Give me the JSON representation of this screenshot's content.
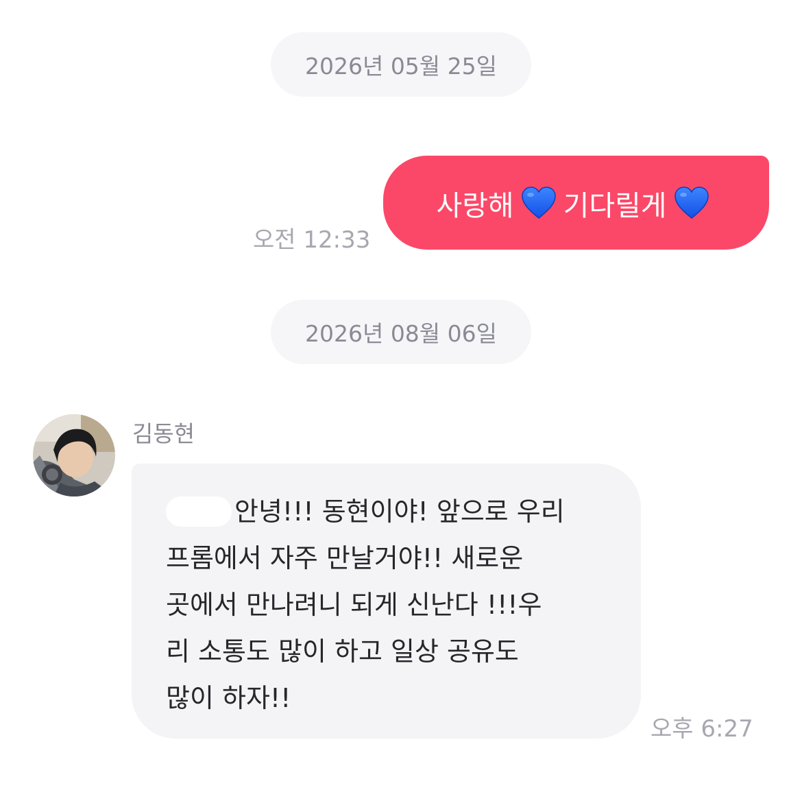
{
  "dates": {
    "first": "2026년 05월 25일",
    "second": "2026년 08월 06일"
  },
  "sent_message": {
    "part1": "사랑해",
    "part2": "기다릴게",
    "emoji": "blue-heart-icon",
    "time": "오전 12:33",
    "bubble_color": "#fb4868"
  },
  "received_message": {
    "sender": "김동현",
    "lines": [
      "안녕!!! 동현이야! 앞으로 우리",
      "프롬에서 자주 만날거야!! 새로운",
      "곳에서 만나려니 되게 신난다 !!!우",
      "리 소통도 많이 하고 일상 공유도",
      "많이 하자!!"
    ],
    "time": "오후 6:27",
    "bubble_color": "#f4f4f7"
  },
  "colors": {
    "accent": "#fb4868",
    "heart": "#1e64ff",
    "muted_text": "#a7a7b0"
  }
}
